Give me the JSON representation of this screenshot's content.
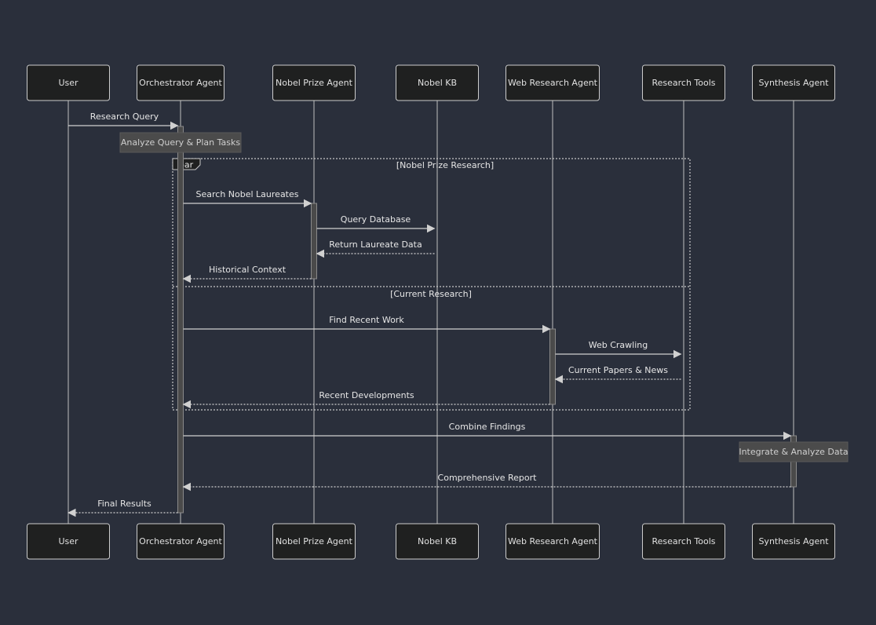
{
  "diagram": {
    "type": "sequence",
    "actors": [
      {
        "id": "user",
        "label": "User"
      },
      {
        "id": "orch",
        "label": "Orchestrator Agent"
      },
      {
        "id": "nobel",
        "label": "Nobel Prize Agent"
      },
      {
        "id": "kb",
        "label": "Nobel KB"
      },
      {
        "id": "web",
        "label": "Web Research Agent"
      },
      {
        "id": "tools",
        "label": "Research Tools"
      },
      {
        "id": "synth",
        "label": "Synthesis Agent"
      }
    ],
    "messages": [
      {
        "from": "user",
        "to": "orch",
        "label": "Research Query",
        "style": "solid"
      },
      {
        "from": "orch",
        "to": "nobel",
        "label": "Search Nobel Laureates",
        "style": "solid"
      },
      {
        "from": "nobel",
        "to": "kb",
        "label": "Query Database",
        "style": "solid"
      },
      {
        "from": "kb",
        "to": "nobel",
        "label": "Return Laureate Data",
        "style": "dotted"
      },
      {
        "from": "nobel",
        "to": "orch",
        "label": "Historical Context",
        "style": "dotted"
      },
      {
        "from": "orch",
        "to": "web",
        "label": "Find Recent Work",
        "style": "solid"
      },
      {
        "from": "web",
        "to": "tools",
        "label": "Web Crawling",
        "style": "solid"
      },
      {
        "from": "tools",
        "to": "web",
        "label": "Current Papers & News",
        "style": "dotted"
      },
      {
        "from": "web",
        "to": "orch",
        "label": "Recent Developments",
        "style": "dotted"
      },
      {
        "from": "orch",
        "to": "synth",
        "label": "Combine Findings",
        "style": "solid"
      },
      {
        "from": "synth",
        "to": "orch",
        "label": "Comprehensive Report",
        "style": "dotted"
      },
      {
        "from": "orch",
        "to": "user",
        "label": "Final Results",
        "style": "dotted"
      }
    ],
    "notes": [
      {
        "over": "orch",
        "label": "Analyze Query & Plan Tasks"
      },
      {
        "over": "synth",
        "label": "Integrate & Analyze Data"
      }
    ],
    "frame": {
      "kind": "par",
      "sections": [
        "[Nobel Prize Research]",
        "[Current Research]"
      ]
    }
  }
}
